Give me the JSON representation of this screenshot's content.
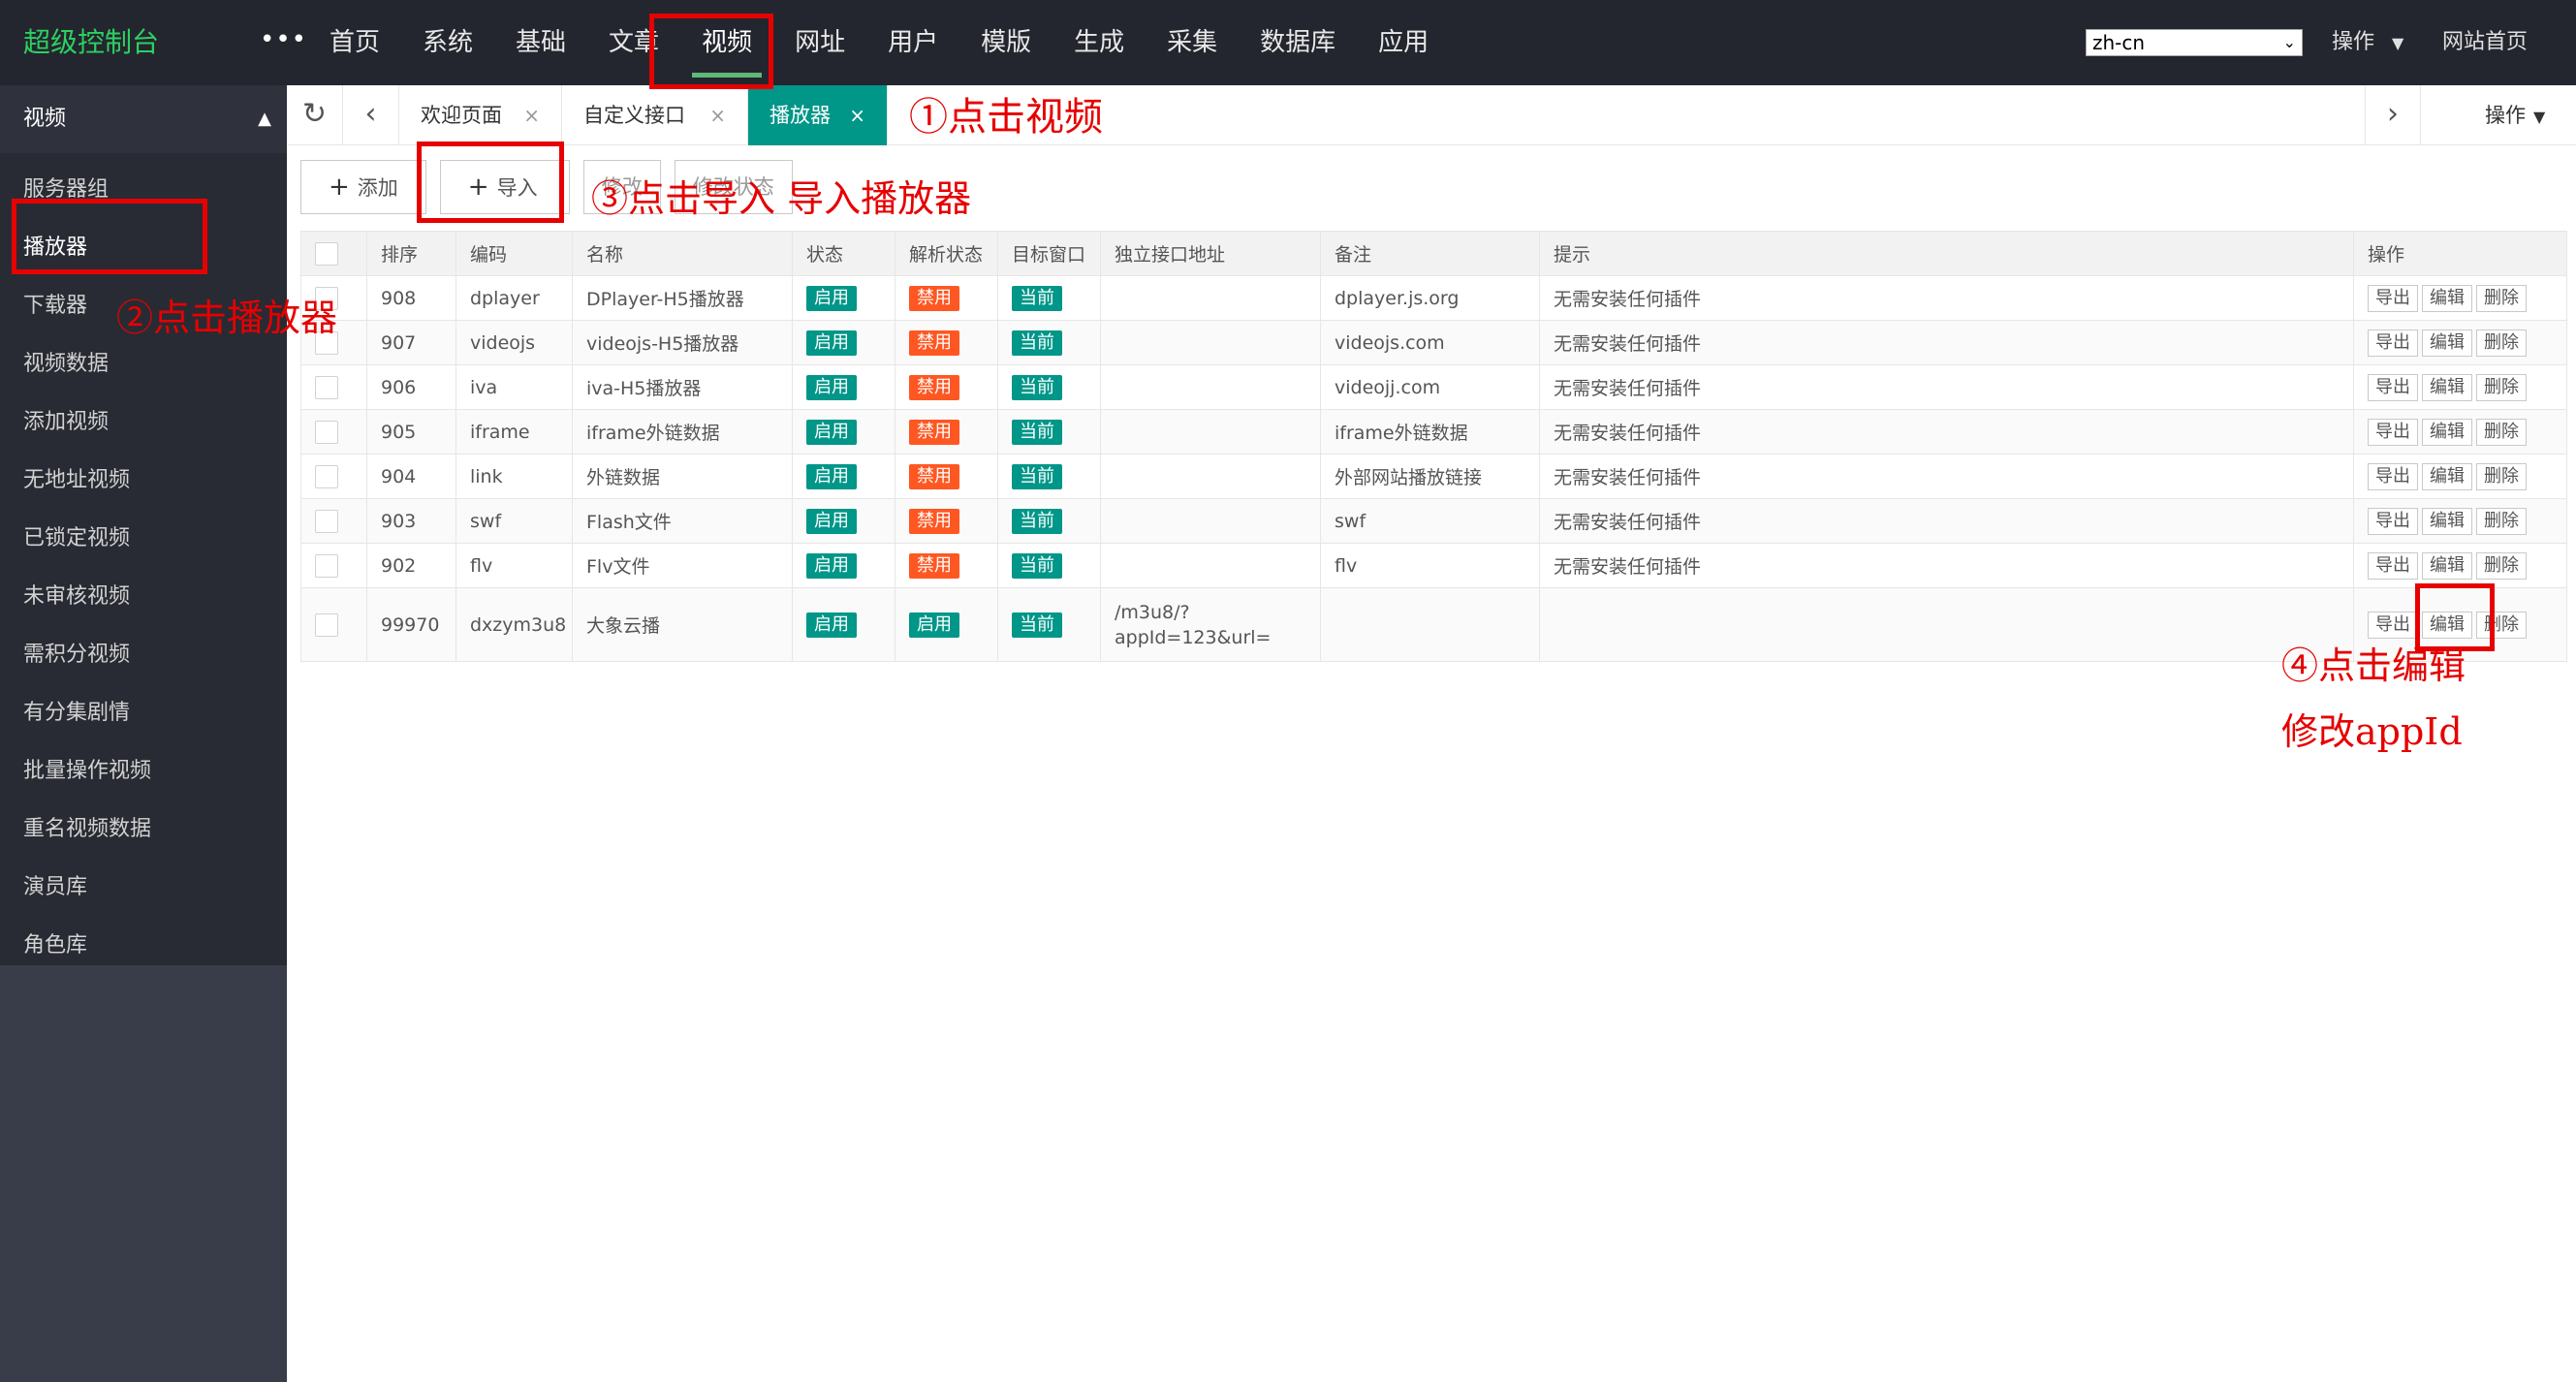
{
  "header": {
    "logo": "超级控制台",
    "more": "•••",
    "nav": [
      "首页",
      "系统",
      "基础",
      "文章",
      "视频",
      "网址",
      "用户",
      "模版",
      "生成",
      "采集",
      "数据库",
      "应用"
    ],
    "lang_value": "zh-cn",
    "operate_label": "操作",
    "home_label": "网站首页"
  },
  "sidebar": {
    "section": "视频",
    "items": [
      "服务器组",
      "播放器",
      "下载器",
      "视频数据",
      "添加视频",
      "无地址视频",
      "已锁定视频",
      "未审核视频",
      "需积分视频",
      "有分集剧情",
      "批量操作视频",
      "重名视频数据",
      "演员库",
      "角色库"
    ]
  },
  "tabs": {
    "items": [
      {
        "label": "欢迎页面",
        "close": "×"
      },
      {
        "label": "自定义接口",
        "close": "×"
      },
      {
        "label": "播放器",
        "close": "×"
      }
    ],
    "operate_label": "操作"
  },
  "toolbar": {
    "add_label": "添加",
    "import_label": "导入",
    "btn3_label": "修改",
    "btn4_label": "修改状态"
  },
  "table": {
    "headers": [
      "排序",
      "编码",
      "名称",
      "状态",
      "解析状态",
      "目标窗口",
      "独立接口地址",
      "备注",
      "提示",
      "操作"
    ],
    "rows": [
      {
        "sort": "908",
        "code": "dplayer",
        "name": "DPlayer-H5播放器",
        "status": "启用",
        "parse": "禁用",
        "target": "当前",
        "api": "",
        "remark": "dplayer.js.org",
        "tip": "无需安装任何插件"
      },
      {
        "sort": "907",
        "code": "videojs",
        "name": "videojs-H5播放器",
        "status": "启用",
        "parse": "禁用",
        "target": "当前",
        "api": "",
        "remark": "videojs.com",
        "tip": "无需安装任何插件"
      },
      {
        "sort": "906",
        "code": "iva",
        "name": "iva-H5播放器",
        "status": "启用",
        "parse": "禁用",
        "target": "当前",
        "api": "",
        "remark": "videojj.com",
        "tip": "无需安装任何插件"
      },
      {
        "sort": "905",
        "code": "iframe",
        "name": "iframe外链数据",
        "status": "启用",
        "parse": "禁用",
        "target": "当前",
        "api": "",
        "remark": "iframe外链数据",
        "tip": "无需安装任何插件"
      },
      {
        "sort": "904",
        "code": "link",
        "name": "外链数据",
        "status": "启用",
        "parse": "禁用",
        "target": "当前",
        "api": "",
        "remark": "外部网站播放链接",
        "tip": "无需安装任何插件"
      },
      {
        "sort": "903",
        "code": "swf",
        "name": "Flash文件",
        "status": "启用",
        "parse": "禁用",
        "target": "当前",
        "api": "",
        "remark": "swf",
        "tip": "无需安装任何插件"
      },
      {
        "sort": "902",
        "code": "flv",
        "name": "Flv文件",
        "status": "启用",
        "parse": "禁用",
        "target": "当前",
        "api": "",
        "remark": "flv",
        "tip": "无需安装任何插件"
      },
      {
        "sort": "99970",
        "code": "dxzym3u8",
        "name": "大象云播",
        "status": "启用",
        "parse": "启用",
        "target": "当前",
        "api": "/m3u8/?appId=123&url=",
        "remark": "",
        "tip": ""
      }
    ],
    "row_actions": [
      "导出",
      "编辑",
      "删除"
    ]
  },
  "annotations": {
    "step1": "①点击视频",
    "step2": "②点击播放器",
    "step3": "③点击导入 导入播放器",
    "step4": "④点击编辑",
    "step4b": "修改appId"
  }
}
